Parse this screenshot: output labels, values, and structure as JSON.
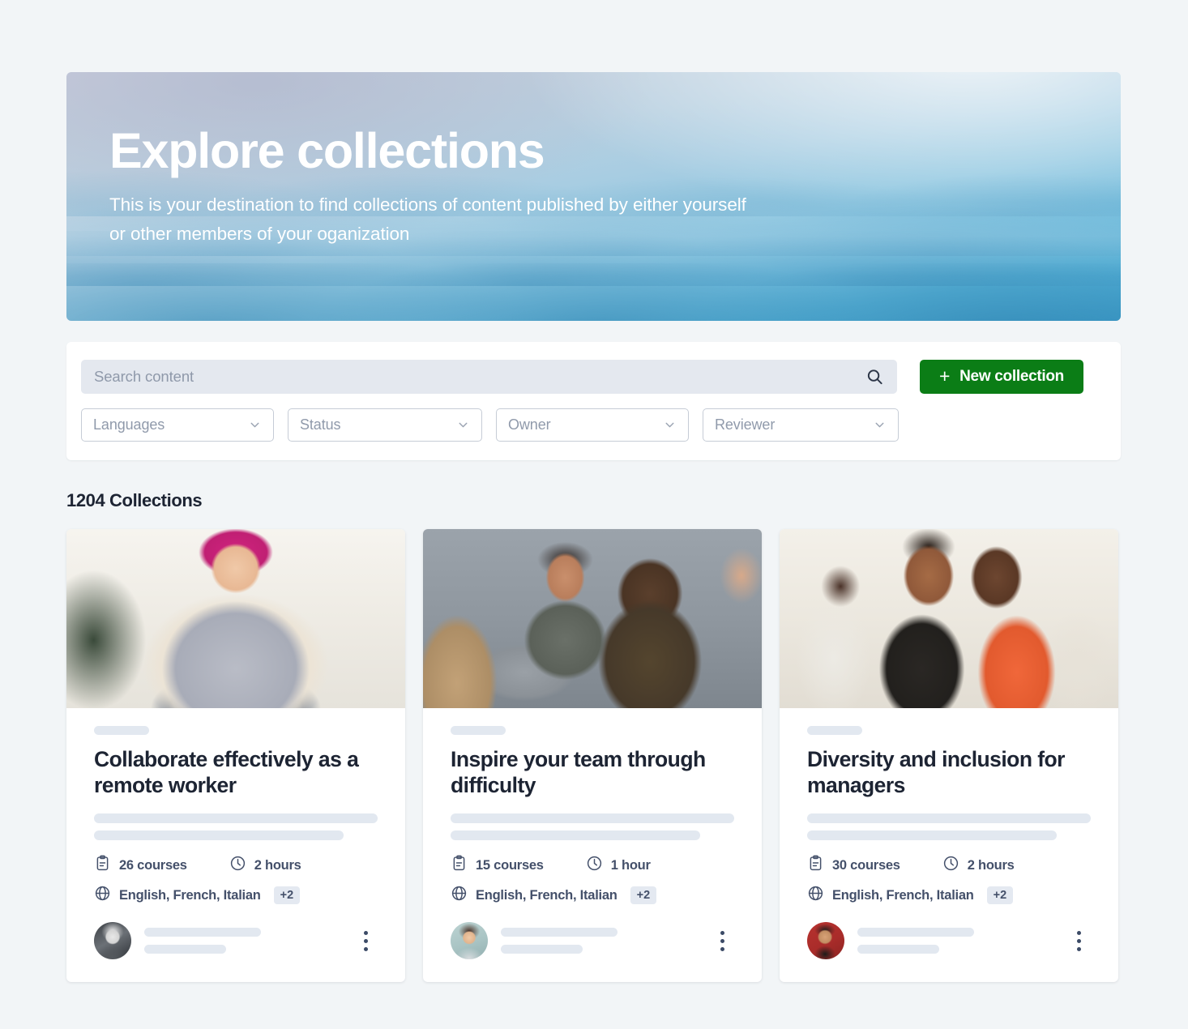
{
  "hero": {
    "title": "Explore collections",
    "subtitle": "This is your destination to find collections of content published by either yourself or other members of your oganization"
  },
  "search": {
    "placeholder": "Search content",
    "value": "",
    "icon": "search-icon",
    "new_collection_label": "New collection",
    "new_collection_plus": "+",
    "accent_green": "#0b7d16"
  },
  "filters": [
    {
      "label": "Languages",
      "icon": "chevron-down-icon"
    },
    {
      "label": "Status",
      "icon": "chevron-down-icon"
    },
    {
      "label": "Owner",
      "icon": "chevron-down-icon"
    },
    {
      "label": "Reviewer",
      "icon": "chevron-down-icon"
    }
  ],
  "results": {
    "count_label": "1204 Collections"
  },
  "cards": [
    {
      "title": "Collaborate effectively as a remote worker",
      "courses": "26 courses",
      "duration": "2 hours",
      "languages": "English, French, Italian",
      "languages_more": "+2",
      "courses_icon": "clipboard-icon",
      "duration_icon": "clock-icon",
      "languages_icon": "globe-icon",
      "menu_icon": "kebab-menu-icon"
    },
    {
      "title": "Inspire your team through difficulty",
      "courses": "15 courses",
      "duration": "1 hour",
      "languages": "English, French, Italian",
      "languages_more": "+2",
      "courses_icon": "clipboard-icon",
      "duration_icon": "clock-icon",
      "languages_icon": "globe-icon",
      "menu_icon": "kebab-menu-icon"
    },
    {
      "title": "Diversity and inclusion for managers",
      "courses": "30 courses",
      "duration": "2 hours",
      "languages": "English, French, Italian",
      "languages_more": "+2",
      "courses_icon": "clipboard-icon",
      "duration_icon": "clock-icon",
      "languages_icon": "globe-icon",
      "menu_icon": "kebab-menu-icon"
    }
  ]
}
